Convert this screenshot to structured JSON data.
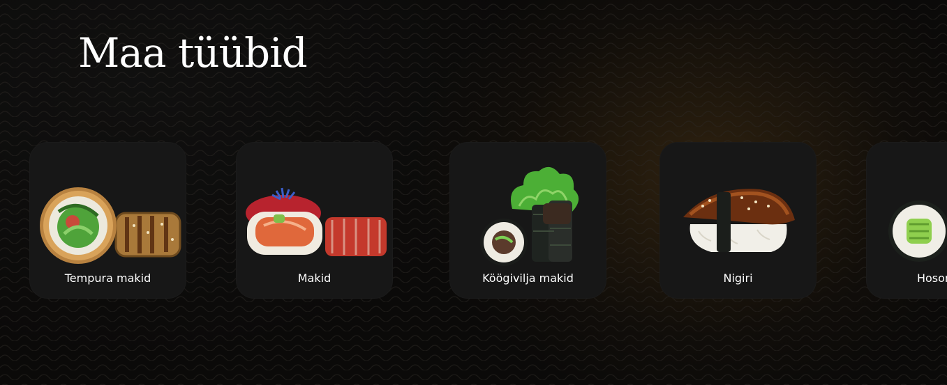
{
  "section": {
    "title": "Maa tüübid"
  },
  "categories": [
    {
      "label": "Tempura makid",
      "image": "tempura-maki-image"
    },
    {
      "label": "Makid",
      "image": "maki-image"
    },
    {
      "label": "Köögivilja makid",
      "image": "vegetable-maki-image"
    },
    {
      "label": "Nigiri",
      "image": "nigiri-image"
    },
    {
      "label": "Hosomaki",
      "image": "hosomaki-image"
    }
  ],
  "colors": {
    "background": "#0b0a09",
    "card": "#171717",
    "text": "#ffffff",
    "glow": "#785219"
  }
}
